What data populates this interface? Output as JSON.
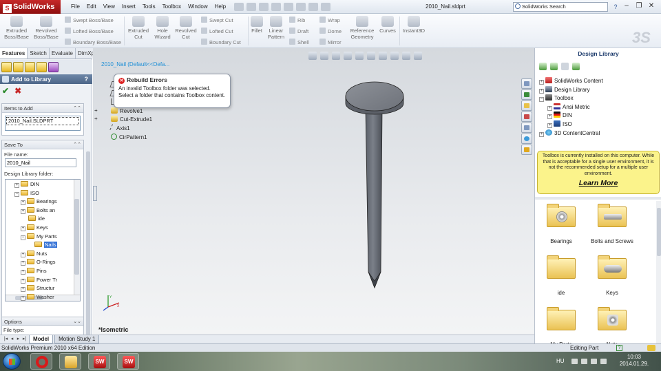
{
  "app": {
    "logo_text": "SolidWorks",
    "doc_title": "2010_Nail.sldprt",
    "menu": [
      "File",
      "Edit",
      "View",
      "Insert",
      "Tools",
      "Toolbox",
      "Window",
      "Help"
    ],
    "search_placeholder": "SolidWorks Search",
    "help_glyph": "?"
  },
  "ribbon": {
    "big": [
      {
        "label": "Extruded Boss/Base"
      },
      {
        "label": "Revolved Boss/Base"
      },
      {
        "label": "Extruded Cut"
      },
      {
        "label": "Hole Wizard"
      },
      {
        "label": "Revolved Cut"
      },
      {
        "label": "Fillet"
      },
      {
        "label": "Linear Pattern"
      },
      {
        "label": "Reference Geometry"
      },
      {
        "label": "Curves"
      },
      {
        "label": "Instant3D"
      }
    ],
    "small": [
      "Swept Boss/Base",
      "Lofted Boss/Base",
      "Boundary Boss/Base",
      "Swept Cut",
      "Lofted Cut",
      "Boundary Cut",
      "Rib",
      "Draft",
      "Shell",
      "Wrap",
      "Dome",
      "Mirror"
    ]
  },
  "manager_tabs": [
    "Features",
    "Sketch",
    "Evaluate",
    "DimXpert",
    "Office Products"
  ],
  "property_manager": {
    "title": "Add to Library",
    "help_glyph": "?",
    "ok_glyph": "✔",
    "cancel_glyph": "✖",
    "items_group": "Items to Add",
    "items": [
      "2010_Nail.SLDPRT"
    ],
    "save_group": "Save To",
    "file_name_label": "File name:",
    "file_name_value": "2010_Nail",
    "library_folder_label": "Design Library folder:",
    "folders": [
      {
        "label": "DIN",
        "exp": "+",
        "indent": 1
      },
      {
        "label": "ISO",
        "exp": "−",
        "indent": 1
      },
      {
        "label": "Bearings",
        "exp": "+",
        "indent": 2
      },
      {
        "label": "Bolts an",
        "exp": "+",
        "indent": 2
      },
      {
        "label": "ide",
        "exp": "",
        "indent": 2
      },
      {
        "label": "Keys",
        "exp": "+",
        "indent": 2
      },
      {
        "label": "My Parts",
        "exp": "−",
        "indent": 2
      },
      {
        "label": "Nails",
        "exp": "",
        "indent": 3,
        "selected": true
      },
      {
        "label": "Nuts",
        "exp": "+",
        "indent": 2
      },
      {
        "label": "O-Rings",
        "exp": "+",
        "indent": 2
      },
      {
        "label": "Pins",
        "exp": "+",
        "indent": 2
      },
      {
        "label": "Power Tr",
        "exp": "+",
        "indent": 2
      },
      {
        "label": "Structur",
        "exp": "+",
        "indent": 2
      },
      {
        "label": "Washer",
        "exp": "+",
        "indent": 2
      }
    ],
    "options_group": "Options",
    "file_type_label": "File type:"
  },
  "feature_tree": {
    "root": "2010_Nail  (Default<<Defa...",
    "rows": [
      {
        "label": "Top Plane",
        "icon": "plane",
        "exp": ""
      },
      {
        "label": "Right Plane",
        "icon": "plane",
        "exp": ""
      },
      {
        "label": "Origin",
        "icon": "origin",
        "exp": ""
      },
      {
        "label": "Revolve1",
        "icon": "feat",
        "exp": "+"
      },
      {
        "label": "Cut-Extrude1",
        "icon": "feat",
        "exp": "+"
      },
      {
        "label": "Axis1",
        "icon": "axis",
        "exp": ""
      },
      {
        "label": "CirPattern1",
        "icon": "pattern",
        "exp": ""
      }
    ]
  },
  "tooltip": {
    "title": "Rebuild Errors",
    "body": "An invalid Toolbox folder was selected. Select a folder that contains Toolbox content."
  },
  "viewport": {
    "view_label": "*Isometric"
  },
  "design_library": {
    "title": "Design Library",
    "tree": [
      {
        "label": "SolidWorks Content",
        "icon": "sw",
        "exp": "+",
        "indent": 0
      },
      {
        "label": "Design Library",
        "icon": "lib",
        "exp": "+",
        "indent": 0
      },
      {
        "label": "Toolbox",
        "icon": "tbx",
        "exp": "−",
        "indent": 0
      },
      {
        "label": "Ansi Metric",
        "icon": "ansi",
        "exp": "+",
        "indent": 1
      },
      {
        "label": "DIN",
        "icon": "din",
        "exp": "+",
        "indent": 1
      },
      {
        "label": "ISO",
        "icon": "iso",
        "exp": "+",
        "indent": 1
      },
      {
        "label": "3D ContentCentral",
        "icon": "cc",
        "exp": "+",
        "indent": 0
      }
    ],
    "notice": "Toolbox is currently installed on this computer. While that is acceptable for a single user environment, it is not the recommended setup for a multiple user environment.",
    "learn_more": "Learn More",
    "tiles": [
      {
        "label": "Bearings",
        "inner": "bearing"
      },
      {
        "label": "Bolts and Screws",
        "inner": "bolt"
      },
      {
        "label": "ide",
        "inner": ""
      },
      {
        "label": "Keys",
        "inner": "key"
      },
      {
        "label": "My Parts",
        "inner": ""
      },
      {
        "label": "Nuts",
        "inner": "nut"
      }
    ]
  },
  "bottom_tabs": [
    "Model",
    "Motion Study 1"
  ],
  "status": {
    "text": "SolidWorks Premium 2010 x64 Edition",
    "mode": "Editing Part",
    "help_glyph": "?"
  },
  "taskbar": {
    "apps": [
      "opera",
      "folder",
      "sw",
      "sw"
    ],
    "sw_glyph": "SW",
    "lang": "HU",
    "time": "10:03",
    "date": "2014.01.29."
  }
}
